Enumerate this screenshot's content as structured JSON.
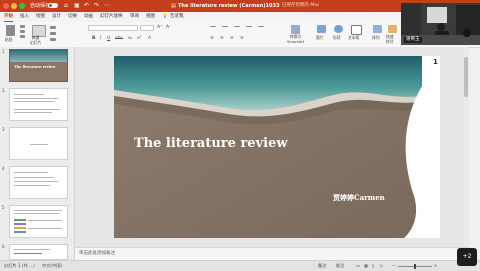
{
  "titlebar": {
    "autosave_label": "自动保存",
    "doc_title": "The literature review (Carmen)1033",
    "doc_subtitle": "— 已保存到我的 Mac",
    "color": "#c43e1c"
  },
  "tabs": [
    {
      "label": "开始"
    },
    {
      "label": "插入"
    },
    {
      "label": "绘图"
    },
    {
      "label": "设计"
    },
    {
      "label": "切换"
    },
    {
      "label": "动画"
    },
    {
      "label": "幻灯片放映"
    },
    {
      "label": "审阅"
    },
    {
      "label": "视图"
    },
    {
      "label": "告诉我"
    }
  ],
  "ribbon": {
    "paste": "粘贴",
    "new_slide": "新建\n幻灯片",
    "font_name": "",
    "font_size": "",
    "convert_smartart": "转换为\nSmartArt",
    "picture": "图片",
    "shape": "形状",
    "textbox": "文本框",
    "arrange": "排列",
    "quick_style": "快速\n样式"
  },
  "thumbnails": [
    {
      "num": "1",
      "title": "The literature review"
    },
    {
      "num": "2",
      "title": ""
    },
    {
      "num": "3",
      "title": ""
    },
    {
      "num": "4",
      "title": ""
    },
    {
      "num": "5",
      "title": ""
    },
    {
      "num": "6",
      "title": ""
    }
  ],
  "slide": {
    "title": "The literature review",
    "author": "贾婷婷Carmen",
    "number": "1"
  },
  "notes": {
    "placeholder": "单击此处添加备注"
  },
  "status": {
    "slide_count": "幻灯片 1 (共 …)",
    "language": "中文(中国)",
    "notes_btn": "备注",
    "comments_btn": "批注",
    "zoom": "…%"
  },
  "video": {
    "participant_name": "谢菁玉",
    "more_count": "+2"
  }
}
